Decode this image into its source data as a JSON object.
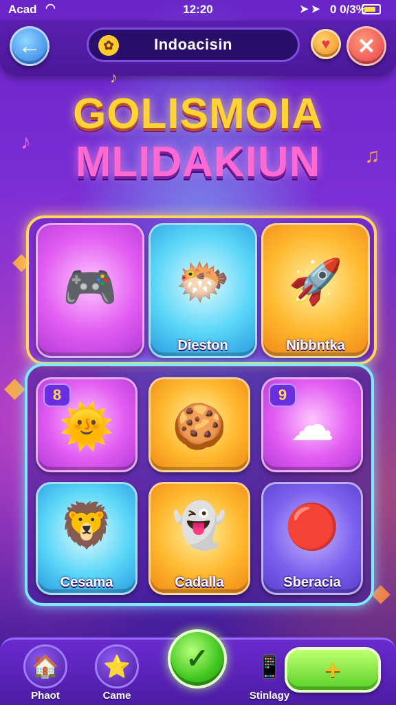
{
  "status_bar": {
    "carrier": "Acad",
    "time": "12:20",
    "battery_text": "0 0/3%"
  },
  "header": {
    "title": "Indoacisin"
  },
  "logo": {
    "line1": "GOLISMOIA",
    "line2": "MLIDAKIUN"
  },
  "featured": {
    "tiles": [
      {
        "label": "",
        "icon": "game-controller-icon",
        "art": "🎮"
      },
      {
        "label": "Dieston",
        "icon": "fish-creature-icon",
        "art": "🐡"
      },
      {
        "label": "Nibbntka",
        "icon": "rocket-icon",
        "art": "🚀"
      }
    ]
  },
  "grid": {
    "tiles": [
      {
        "label": "",
        "icon": "sun-character-icon",
        "art": "🌞",
        "badge": "8"
      },
      {
        "label": "",
        "icon": "cookie-character-icon",
        "art": "🍪",
        "badge": ""
      },
      {
        "label": "",
        "icon": "cloud-character-icon",
        "art": "☁",
        "badge": "9"
      },
      {
        "label": "Cesama",
        "icon": "lion-character-icon",
        "art": "🦁",
        "badge": ""
      },
      {
        "label": "Cadalla",
        "icon": "ghost-character-icon",
        "art": "👻",
        "badge": ""
      },
      {
        "label": "Sberacia",
        "icon": "ball-icon",
        "art": "🔴",
        "badge": ""
      }
    ]
  },
  "bottom_nav": {
    "items": [
      {
        "label": "Phaot",
        "icon": "home-icon",
        "glyph": "🏠"
      },
      {
        "label": "Came",
        "icon": "star-wand-icon",
        "glyph": "⭐"
      },
      {
        "label": "Stinlagy",
        "icon": "phone-icon",
        "glyph": "📱"
      }
    ],
    "play_glyph": "✓",
    "add_glyph": "+"
  }
}
